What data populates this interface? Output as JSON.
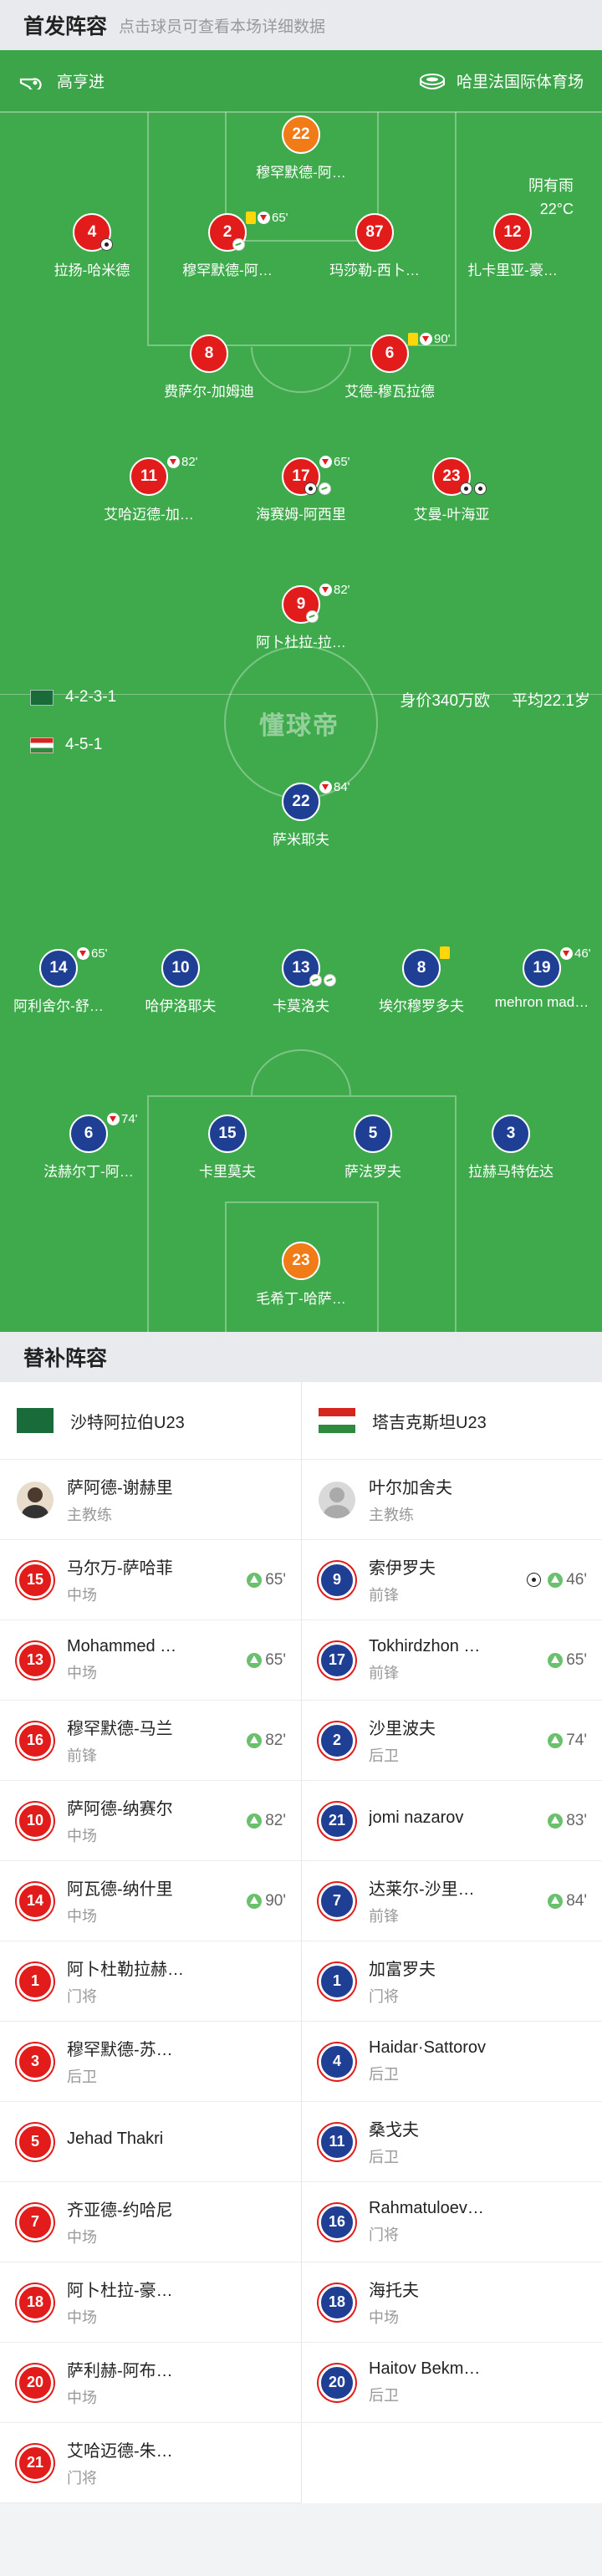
{
  "header": {
    "title": "首发阵容",
    "subtitle": "点击球员可查看本场详细数据"
  },
  "pitch": {
    "referee": "高亨进",
    "venue": "哈里法国际体育场",
    "weather": "阴有雨",
    "temperature": "22°C",
    "home_formation": "4-2-3-1",
    "away_formation": "4-5-1",
    "watermark": "懂球帝",
    "home_value": "身价340万欧",
    "home_avg_age": "平均22.1岁"
  },
  "home_players": [
    {
      "num": "22",
      "name": "穆罕默德-阿…",
      "gk": true
    },
    {
      "num": "4",
      "name": "拉扬-哈米德",
      "time": ""
    },
    {
      "num": "2",
      "name": "穆罕默德-阿…",
      "time": "65'"
    },
    {
      "num": "87",
      "name": "玛莎勒-西卜…",
      "time": ""
    },
    {
      "num": "12",
      "name": "扎卡里亚-豪…",
      "time": ""
    },
    {
      "num": "8",
      "name": "费萨尔-加姆迪",
      "time": ""
    },
    {
      "num": "6",
      "name": "艾德-穆瓦拉德",
      "time": "90'"
    },
    {
      "num": "11",
      "name": "艾哈迈德-加…",
      "time": "82'"
    },
    {
      "num": "17",
      "name": "海赛姆-阿西里",
      "time": "65'"
    },
    {
      "num": "23",
      "name": "艾曼-叶海亚",
      "time": ""
    },
    {
      "num": "9",
      "name": "阿卜杜拉-拉…",
      "time": "82'"
    }
  ],
  "away_players": [
    {
      "num": "22",
      "name": "萨米耶夫",
      "time": "84'"
    },
    {
      "num": "14",
      "name": "阿利舍尔-舒…",
      "time": "65'"
    },
    {
      "num": "10",
      "name": "哈伊洛耶夫",
      "time": ""
    },
    {
      "num": "13",
      "name": "卡莫洛夫",
      "time": ""
    },
    {
      "num": "8",
      "name": "埃尔穆罗多夫",
      "time": ""
    },
    {
      "num": "19",
      "name": "mehron mad…",
      "time": "46'"
    },
    {
      "num": "6",
      "name": "法赫尔丁-阿…",
      "time": "74'"
    },
    {
      "num": "15",
      "name": "卡里莫夫",
      "time": ""
    },
    {
      "num": "5",
      "name": "萨法罗夫",
      "time": ""
    },
    {
      "num": "3",
      "name": "拉赫马特佐达",
      "time": ""
    },
    {
      "num": "23",
      "name": "毛希丁-哈萨…",
      "gk": true
    }
  ],
  "subs": {
    "title": "替补阵容",
    "home": {
      "team": "沙特阿拉伯U23",
      "coach": {
        "name": "萨阿德-谢赫里",
        "role": "主教练"
      },
      "players": [
        {
          "num": "15",
          "name": "马尔万-萨哈菲",
          "pos": "中场",
          "time": "65'"
        },
        {
          "num": "13",
          "name": "Mohammed …",
          "pos": "中场",
          "time": "65'"
        },
        {
          "num": "16",
          "name": "穆罕默德-马兰",
          "pos": "前锋",
          "time": "82'"
        },
        {
          "num": "10",
          "name": "萨阿德-纳赛尔",
          "pos": "中场",
          "time": "82'"
        },
        {
          "num": "14",
          "name": "阿瓦德-纳什里",
          "pos": "中场",
          "time": "90'"
        },
        {
          "num": "1",
          "name": "阿卜杜勒拉赫…",
          "pos": "门将",
          "time": ""
        },
        {
          "num": "3",
          "name": "穆罕默德-苏…",
          "pos": "后卫",
          "time": ""
        },
        {
          "num": "5",
          "name": "Jehad Thakri",
          "pos": "",
          "time": ""
        },
        {
          "num": "7",
          "name": "齐亚德-约哈尼",
          "pos": "中场",
          "time": ""
        },
        {
          "num": "18",
          "name": "阿卜杜拉-豪…",
          "pos": "中场",
          "time": ""
        },
        {
          "num": "20",
          "name": "萨利赫-阿布…",
          "pos": "中场",
          "time": ""
        },
        {
          "num": "21",
          "name": "艾哈迈德-朱…",
          "pos": "门将",
          "time": ""
        }
      ]
    },
    "away": {
      "team": "塔吉克斯坦U23",
      "coach": {
        "name": "叶尔加舍夫",
        "role": "主教练"
      },
      "players": [
        {
          "num": "9",
          "name": "索伊罗夫",
          "pos": "前锋",
          "time": "46'"
        },
        {
          "num": "17",
          "name": "Tokhirdzhon …",
          "pos": "前锋",
          "time": "65'"
        },
        {
          "num": "2",
          "name": "沙里波夫",
          "pos": "后卫",
          "time": "74'"
        },
        {
          "num": "21",
          "name": "jomi nazarov",
          "pos": "",
          "time": "83'"
        },
        {
          "num": "7",
          "name": "达莱尔-沙里…",
          "pos": "前锋",
          "time": "84'"
        },
        {
          "num": "1",
          "name": "加富罗夫",
          "pos": "门将",
          "time": ""
        },
        {
          "num": "4",
          "name": "Haidar·Sattorov",
          "pos": "后卫",
          "time": ""
        },
        {
          "num": "11",
          "name": "桑戈夫",
          "pos": "后卫",
          "time": ""
        },
        {
          "num": "16",
          "name": "Rahmatuloev…",
          "pos": "门将",
          "time": ""
        },
        {
          "num": "18",
          "name": "海托夫",
          "pos": "中场",
          "time": ""
        },
        {
          "num": "20",
          "name": "Haitov Bekm…",
          "pos": "后卫",
          "time": ""
        }
      ]
    }
  }
}
